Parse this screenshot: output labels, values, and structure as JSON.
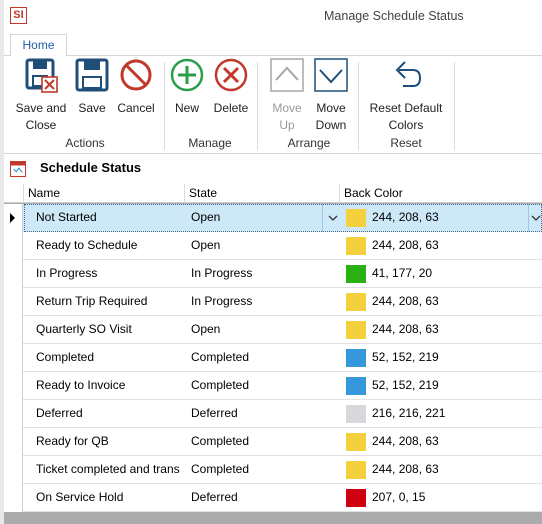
{
  "window": {
    "app_icon_text": "SI",
    "title": "Manage Schedule Status"
  },
  "tabs": [
    {
      "label": "Home"
    }
  ],
  "ribbon": {
    "groups": [
      {
        "label": "Actions",
        "buttons": [
          {
            "label_1": "Save and",
            "label_2": "Close",
            "icon": "save-close-icon"
          },
          {
            "label_1": "Save",
            "icon": "save-icon"
          },
          {
            "label_1": "Cancel",
            "icon": "cancel-icon"
          }
        ]
      },
      {
        "label": "Manage",
        "buttons": [
          {
            "label_1": "New",
            "icon": "plus-icon"
          },
          {
            "label_1": "Delete",
            "icon": "delete-icon"
          }
        ]
      },
      {
        "label": "Arrange",
        "buttons": [
          {
            "label_1": "Move",
            "label_2": "Up",
            "icon": "move-up-icon",
            "enabled": false
          },
          {
            "label_1": "Move",
            "label_2": "Down",
            "icon": "move-down-icon",
            "enabled": true
          }
        ]
      },
      {
        "label": "Reset",
        "buttons": [
          {
            "label_1": "Reset Default",
            "label_2": "Colors",
            "icon": "undo-icon"
          }
        ]
      }
    ]
  },
  "panel": {
    "title": "Schedule Status"
  },
  "grid": {
    "columns": [
      {
        "label": "Name"
      },
      {
        "label": "State"
      },
      {
        "label": "Back Color"
      }
    ],
    "rows": [
      {
        "name": "Not Started",
        "state": "Open",
        "color_text": "244, 208, 63",
        "color_hex": "#f4d03f",
        "selected": true
      },
      {
        "name": "Ready to Schedule",
        "state": "Open",
        "color_text": "244, 208, 63",
        "color_hex": "#f4d03f"
      },
      {
        "name": "In Progress",
        "state": "In Progress",
        "color_text": "41, 177, 20",
        "color_hex": "#29b114"
      },
      {
        "name": "Return Trip Required",
        "state": "In Progress",
        "color_text": "244, 208, 63",
        "color_hex": "#f4d03f"
      },
      {
        "name": "Quarterly SO Visit",
        "state": "Open",
        "color_text": "244, 208, 63",
        "color_hex": "#f4d03f"
      },
      {
        "name": "Completed",
        "state": "Completed",
        "color_text": "52, 152, 219",
        "color_hex": "#3498db"
      },
      {
        "name": "Ready to Invoice",
        "state": "Completed",
        "color_text": "52, 152, 219",
        "color_hex": "#3498db"
      },
      {
        "name": "Deferred",
        "state": "Deferred",
        "color_text": "216, 216, 221",
        "color_hex": "#d8d8dd"
      },
      {
        "name": "Ready for QB",
        "state": "Completed",
        "color_text": "244, 208, 63",
        "color_hex": "#f4d03f"
      },
      {
        "name": "Ticket completed and trans",
        "state": "Completed",
        "color_text": "244, 208, 63",
        "color_hex": "#f4d03f"
      },
      {
        "name": "On Service Hold",
        "state": "Deferred",
        "color_text": "207, 0, 15",
        "color_hex": "#cf000f"
      }
    ]
  },
  "colors": {
    "accent_blue": "#1e5fa8",
    "selected_row": "#cde8f7",
    "icon_green": "#2a9d4a",
    "icon_red": "#c0392b",
    "icon_navy": "#1f4e79"
  }
}
